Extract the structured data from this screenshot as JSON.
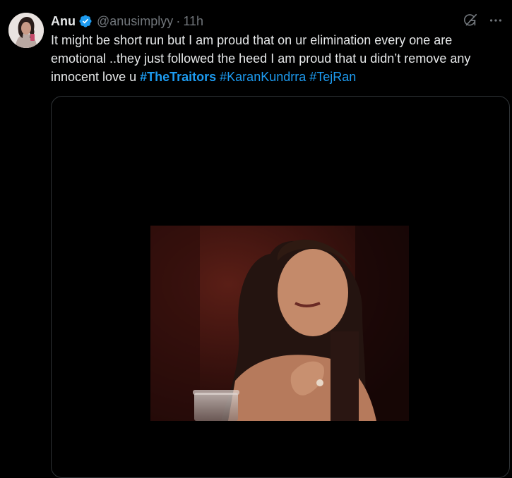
{
  "author": {
    "display_name": "Anu",
    "handle": "@anusimplyy",
    "separator": "·",
    "time": "11h",
    "verified_icon": "verified-badge-icon"
  },
  "tweet": {
    "text_plain": "It might be short run but I am proud that on ur elimination every one are emotional ..they just followed the heed I am proud that u didn’t remove any innocent love u ",
    "hashtags": [
      "#TheTraitors",
      "#KaranKundrra",
      "#TejRan"
    ]
  },
  "actions": {
    "grok_icon": "grok-icon",
    "more_icon": "more-options-icon"
  },
  "colors": {
    "background": "#000000",
    "text": "#e7e9ea",
    "muted": "#71767b",
    "link": "#1d9bf0",
    "border": "#2f3336"
  }
}
